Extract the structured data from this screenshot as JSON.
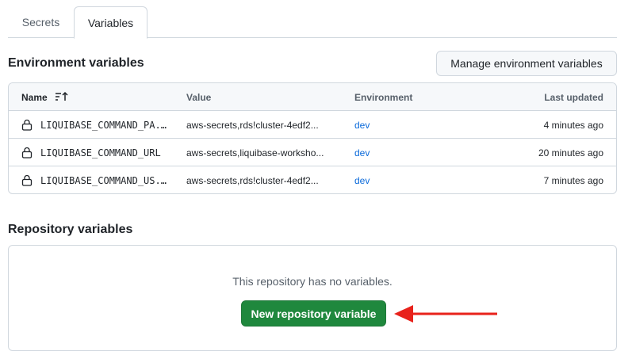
{
  "tabs": [
    {
      "label": "Secrets",
      "active": false
    },
    {
      "label": "Variables",
      "active": true
    }
  ],
  "environment": {
    "title": "Environment variables",
    "manage_button": "Manage environment variables",
    "columns": {
      "name": "Name",
      "value": "Value",
      "environment": "Environment",
      "last_updated": "Last updated"
    },
    "rows": [
      {
        "name": "LIQUIBASE_COMMAND_PA...",
        "value": "aws-secrets,rds!cluster-4edf2...",
        "environment": "dev",
        "last_updated": "4 minutes ago"
      },
      {
        "name": "LIQUIBASE_COMMAND_URL",
        "value": "aws-secrets,liquibase-worksho...",
        "environment": "dev",
        "last_updated": "20 minutes ago"
      },
      {
        "name": "LIQUIBASE_COMMAND_US...",
        "value": "aws-secrets,rds!cluster-4edf2...",
        "environment": "dev",
        "last_updated": "7 minutes ago"
      }
    ]
  },
  "repository": {
    "title": "Repository variables",
    "empty_text": "This repository has no variables.",
    "new_button": "New repository variable"
  },
  "colors": {
    "accent_green": "#1f883d",
    "link_blue": "#0969da",
    "annotation_arrow": "#e8221b"
  },
  "icons": {
    "sort": "sort-ascending-icon",
    "lock": "lock-icon",
    "annotation": "red-arrow-icon"
  }
}
